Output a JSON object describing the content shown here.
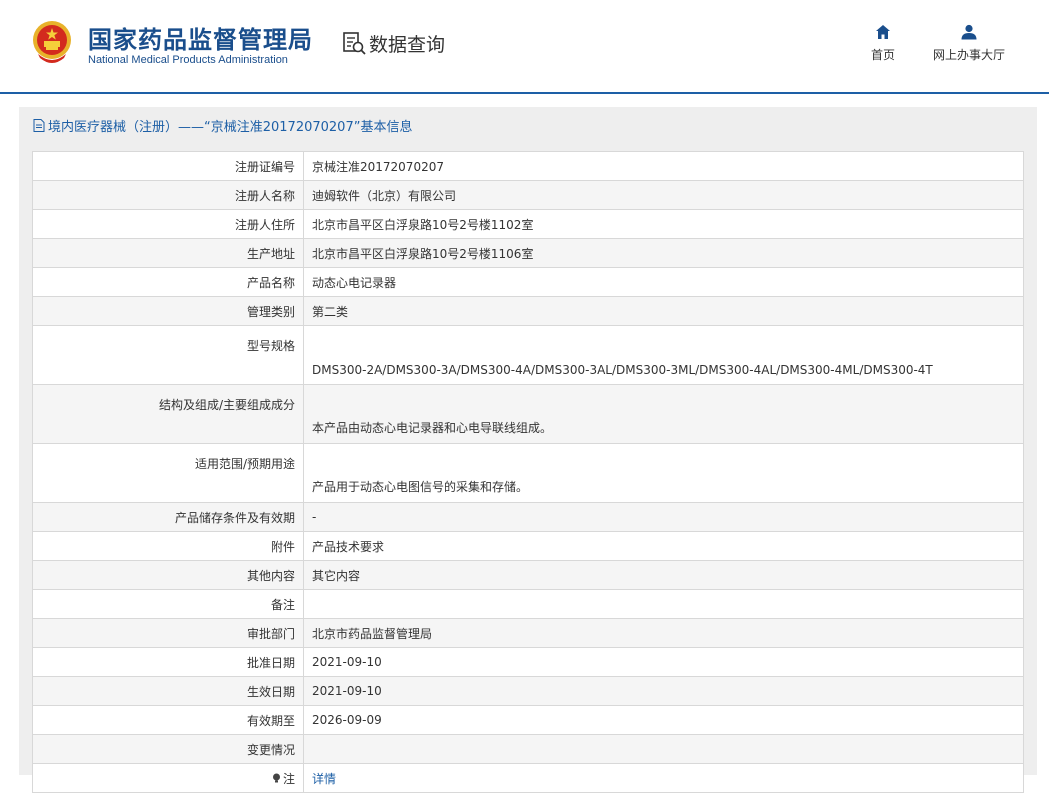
{
  "header": {
    "org_name_cn": "国家药品监督管理局",
    "org_name_en": "National Medical Products Administration",
    "section": "数据查询",
    "nav": [
      {
        "label": "首页",
        "icon": "home-icon"
      },
      {
        "label": "网上办事大厅",
        "icon": "user-icon"
      }
    ]
  },
  "colors": {
    "brand": "#1a4e8c",
    "accent": "#1d5fa6",
    "panel": "#eeeeee",
    "border": "#d8d8d8"
  },
  "panel": {
    "title": "境内医疗器械（注册）——“京械注准20172070207”基本信息"
  },
  "details": [
    {
      "label": "注册证编号",
      "value": "京械注准20172070207"
    },
    {
      "label": "注册人名称",
      "value": "迪姆软件（北京）有限公司"
    },
    {
      "label": "注册人住所",
      "value": "北京市昌平区白浮泉路10号2号楼1102室"
    },
    {
      "label": "生产地址",
      "value": "北京市昌平区白浮泉路10号2号楼1106室"
    },
    {
      "label": "产品名称",
      "value": "动态心电记录器"
    },
    {
      "label": "管理类别",
      "value": "第二类"
    },
    {
      "label": "型号规格",
      "value": "DMS300-2A/DMS300-3A/DMS300-4A/DMS300-3AL/DMS300-3ML/DMS300-4AL/DMS300-4ML/DMS300-4T"
    },
    {
      "label": "结构及组成/主要组成成分",
      "value": "本产品由动态心电记录器和心电导联线组成。"
    },
    {
      "label": "适用范围/预期用途",
      "value": "产品用于动态心电图信号的采集和存储。"
    },
    {
      "label": "产品储存条件及有效期",
      "value": "-"
    },
    {
      "label": "附件",
      "value": "产品技术要求"
    },
    {
      "label": "其他内容",
      "value": "其它内容"
    },
    {
      "label": "备注",
      "value": ""
    },
    {
      "label": "审批部门",
      "value": "北京市药品监督管理局"
    },
    {
      "label": "批准日期",
      "value": "2021-09-10"
    },
    {
      "label": "生效日期",
      "value": "2021-09-10"
    },
    {
      "label": "有效期至",
      "value": "2026-09-09"
    },
    {
      "label": "变更情况",
      "value": ""
    },
    {
      "label": "注",
      "value": "详情"
    }
  ]
}
